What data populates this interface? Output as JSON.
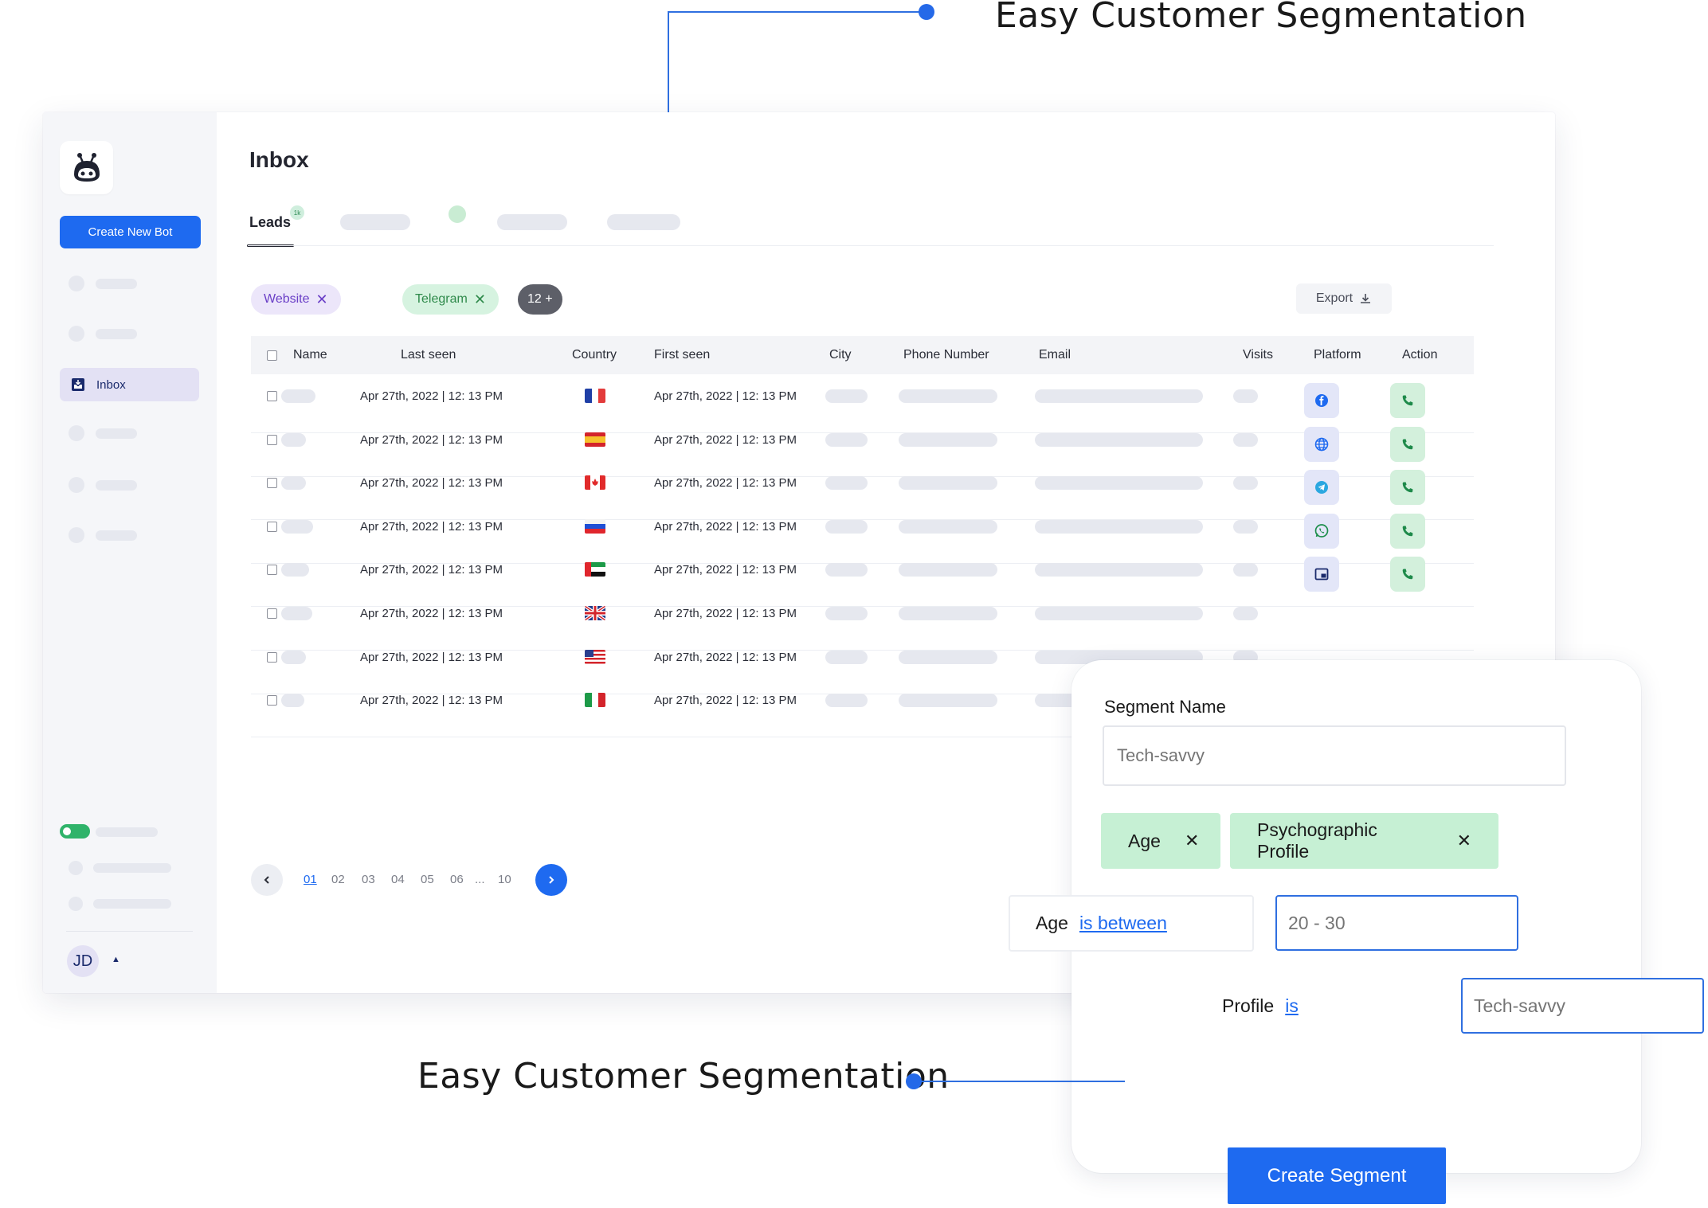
{
  "callouts": {
    "top_title": "Easy Customer Segmentation",
    "bottom_title": "Easy Customer Segmentation"
  },
  "sidebar": {
    "create_button": "Create New Bot",
    "inbox_label": "Inbox",
    "avatar_initials": "JD",
    "caret": "▲"
  },
  "header": {
    "title": "Inbox",
    "tab_leads": "Leads",
    "tab_badge": "1k"
  },
  "filters": {
    "website": "Website",
    "telegram": "Telegram",
    "more": "12 +",
    "remove_glyph": "✕",
    "export": "Export"
  },
  "table": {
    "headers": {
      "name": "Name",
      "last_seen": "Last seen",
      "country": "Country",
      "first_seen": "First seen",
      "city": "City",
      "phone": "Phone Number",
      "email": "Email",
      "visits": "Visits",
      "platform": "Platform",
      "action": "Action"
    },
    "rows": [
      {
        "last_seen": "Apr 27th, 2022 | 12: 13 PM",
        "first_seen": "Apr 27th, 2022 | 12: 13 PM",
        "flag": "france",
        "platform": "facebook"
      },
      {
        "last_seen": "Apr 27th, 2022 | 12: 13 PM",
        "first_seen": "Apr 27th, 2022 | 12: 13 PM",
        "flag": "spain",
        "platform": "website"
      },
      {
        "last_seen": "Apr 27th, 2022 | 12: 13 PM",
        "first_seen": "Apr 27th, 2022 | 12: 13 PM",
        "flag": "canada",
        "platform": "telegram"
      },
      {
        "last_seen": "Apr 27th, 2022 | 12: 13 PM",
        "first_seen": "Apr 27th, 2022 | 12: 13 PM",
        "flag": "russia",
        "platform": "whatsapp"
      },
      {
        "last_seen": "Apr 27th, 2022 | 12: 13 PM",
        "first_seen": "Apr 27th, 2022 | 12: 13 PM",
        "flag": "uae",
        "platform": "widget"
      },
      {
        "last_seen": "Apr 27th, 2022 | 12: 13 PM",
        "first_seen": "Apr 27th, 2022 | 12: 13 PM",
        "flag": "uk",
        "platform": ""
      },
      {
        "last_seen": "Apr 27th, 2022 | 12: 13 PM",
        "first_seen": "Apr 27th, 2022 | 12: 13 PM",
        "flag": "usa",
        "platform": ""
      },
      {
        "last_seen": "Apr 27th, 2022 | 12: 13 PM",
        "first_seen": "Apr 27th, 2022 | 12: 13 PM",
        "flag": "italy",
        "platform": ""
      }
    ]
  },
  "pagination": {
    "pages": [
      "01",
      "02",
      "03",
      "04",
      "05",
      "06",
      "...",
      "10"
    ],
    "current": "01"
  },
  "segment": {
    "name_label": "Segment Name",
    "name_placeholder": "Tech-savvy",
    "chip_age": "Age",
    "chip_profile": "Psychographic Profile",
    "remove_glyph": "✕",
    "age_label": "Age",
    "age_operator": "is between",
    "age_value_placeholder": "20 - 30",
    "profile_label": "Profile",
    "profile_operator": "is",
    "profile_value_placeholder": "Tech-savvy",
    "create_button": "Create Segment"
  },
  "colors": {
    "accent": "#1e6af0",
    "success": "#2fb36a",
    "chip_green": "#c6f0d4",
    "chip_purple": "#ece6fa"
  }
}
